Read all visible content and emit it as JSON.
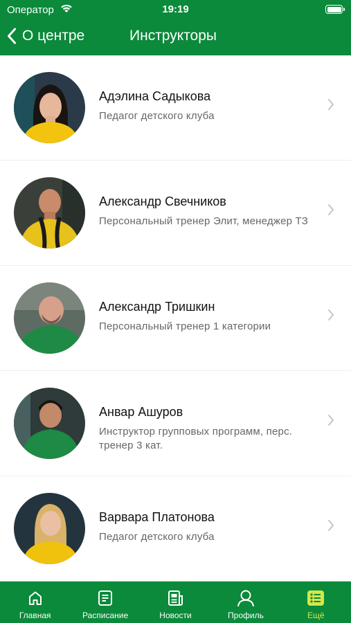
{
  "status_bar": {
    "carrier": "Оператор",
    "time": "19:19"
  },
  "nav": {
    "back_label": "О центре",
    "title": "Инструкторы"
  },
  "instructors": [
    {
      "name": "Адэлина Садыкова",
      "role": "Педагог детского клуба"
    },
    {
      "name": "Александр Свечников",
      "role": "Персональный тренер Элит, менеджер ТЗ"
    },
    {
      "name": "Александр Тришкин",
      "role": "Персональный тренер 1 категории"
    },
    {
      "name": "Анвар Ашуров",
      "role": "Инструктор групповых программ, перс. тренер 3 кат."
    },
    {
      "name": "Варвара Платонова",
      "role": "Педагог детского клуба"
    }
  ],
  "tabs": [
    {
      "label": "Главная",
      "icon": "home-icon"
    },
    {
      "label": "Расписание",
      "icon": "schedule-icon"
    },
    {
      "label": "Новости",
      "icon": "news-icon"
    },
    {
      "label": "Профиль",
      "icon": "profile-icon"
    },
    {
      "label": "Ещё",
      "icon": "more-icon"
    }
  ],
  "colors": {
    "brand_green": "#0a8a3a",
    "active_tab": "#d6e64a"
  }
}
